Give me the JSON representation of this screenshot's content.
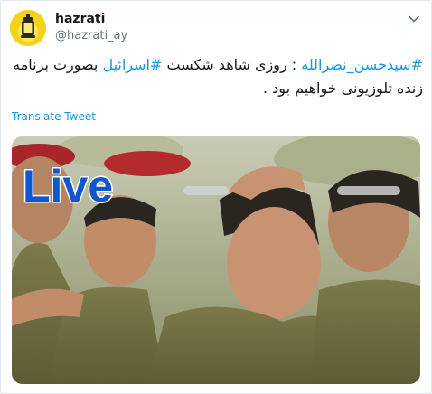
{
  "tweet": {
    "display_name": "hazrati",
    "handle": "@hazrati_ay",
    "text_hashtag_1": "#سیدحسن_نصرالله",
    "text_part_1": " : روزی شاهد شکست ",
    "text_hashtag_2": "#اسرائیل",
    "text_part_2": " بصورت برنامه زنده تلوزیونی خواهیم بود .",
    "translate_label": "Translate Tweet",
    "media_overlay_text": "Live"
  },
  "icons": {
    "menu": "chevron-down-icon",
    "avatar": "lantern-logo"
  },
  "colors": {
    "link": "#1b95e0",
    "text": "#14171a",
    "secondary": "#657786",
    "overlay_text": "#0f56cf"
  }
}
